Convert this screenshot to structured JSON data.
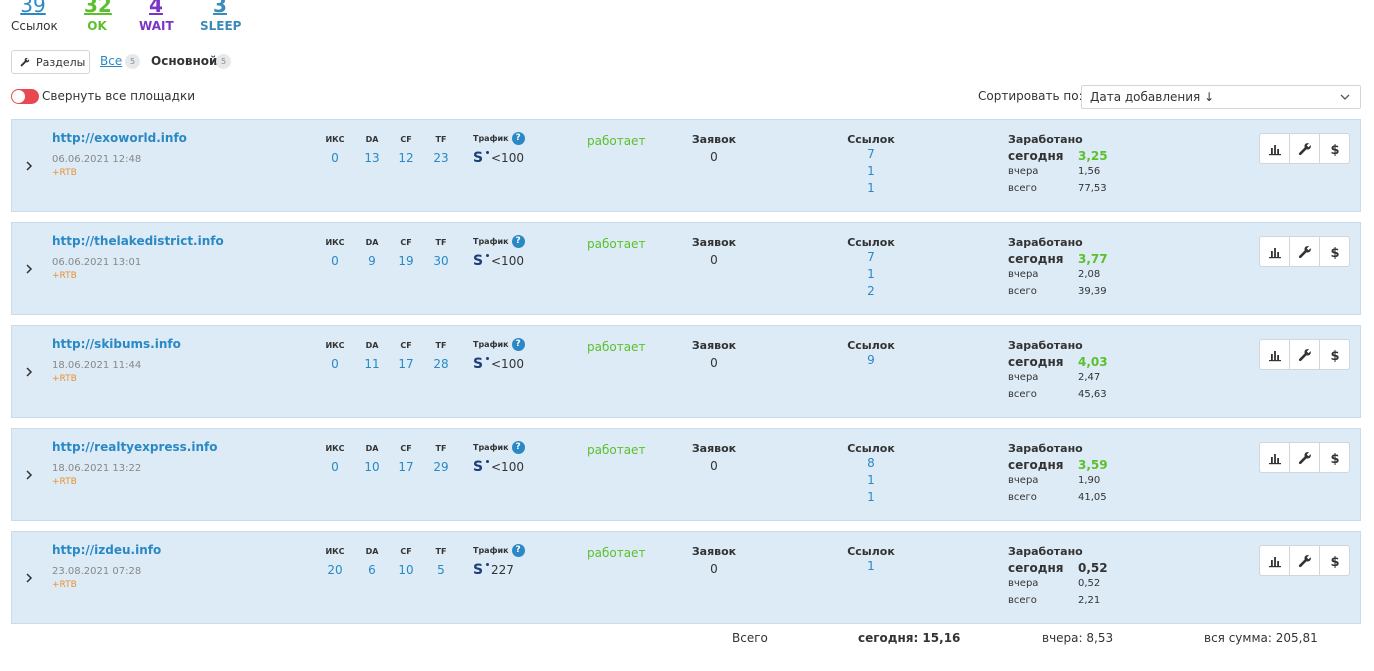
{
  "stats": {
    "links": {
      "value": "39",
      "label": "Ссылок",
      "color": "#2a89c4"
    },
    "ok": {
      "value": "32",
      "label": "OK",
      "color": "#5cc02c"
    },
    "wait": {
      "value": "4",
      "label": "WAIT",
      "color": "#7a35c4"
    },
    "sleep": {
      "value": "3",
      "label": "SLEEP",
      "color": "#3a8bb8"
    }
  },
  "sections": {
    "button_label": "Разделы",
    "button_icon": "wrench-icon",
    "tab_all": "Все",
    "tab_all_count": "5",
    "tab_main": "Основной",
    "tab_main_count": "5"
  },
  "toggle": {
    "label": "Свернуть все площадки",
    "state": "off",
    "color": "#e8484f"
  },
  "sort": {
    "label": "Сортировать по:",
    "selected": "Дата добавления ↓"
  },
  "columns": {
    "iks": "ИКС",
    "da": "DA",
    "cf": "CF",
    "tf": "TF",
    "traffic": "Трафик",
    "requests": "Заявок",
    "links": "Ссылок",
    "earned": "Заработано",
    "today": "сегодня",
    "yesterday": "вчера",
    "total": "всего"
  },
  "sites": [
    {
      "url": "http://exoworld.info",
      "date": "06.06.2021 12:48",
      "tag": "+RTB",
      "iks": "0",
      "da": "13",
      "cf": "12",
      "tf": "23",
      "traffic": "<100",
      "status": "работает",
      "requests": "0",
      "links": [
        "7",
        "1",
        "1"
      ],
      "today": "3,25",
      "yesterday": "1,56",
      "total": "77,53",
      "today_highlight": true
    },
    {
      "url": "http://thelakedistrict.info",
      "date": "06.06.2021 13:01",
      "tag": "+RTB",
      "iks": "0",
      "da": "9",
      "cf": "19",
      "tf": "30",
      "traffic": "<100",
      "status": "работает",
      "requests": "0",
      "links": [
        "7",
        "1",
        "2"
      ],
      "today": "3,77",
      "yesterday": "2,08",
      "total": "39,39",
      "today_highlight": true
    },
    {
      "url": "http://skibums.info",
      "date": "18.06.2021 11:44",
      "tag": "+RTB",
      "iks": "0",
      "da": "11",
      "cf": "17",
      "tf": "28",
      "traffic": "<100",
      "status": "работает",
      "requests": "0",
      "links": [
        "9"
      ],
      "today": "4,03",
      "yesterday": "2,47",
      "total": "45,63",
      "today_highlight": true
    },
    {
      "url": "http://realtyexpress.info",
      "date": "18.06.2021 13:22",
      "tag": "+RTB",
      "iks": "0",
      "da": "10",
      "cf": "17",
      "tf": "29",
      "traffic": "<100",
      "status": "работает",
      "requests": "0",
      "links": [
        "8",
        "1",
        "1"
      ],
      "today": "3,59",
      "yesterday": "1,90",
      "total": "41,05",
      "today_highlight": true
    },
    {
      "url": "http://izdeu.info",
      "date": "23.08.2021 07:28",
      "tag": "+RTB",
      "iks": "20",
      "da": "6",
      "cf": "10",
      "tf": "5",
      "traffic": "227",
      "status": "работает",
      "requests": "0",
      "links": [
        "1"
      ],
      "today": "0,52",
      "yesterday": "0,52",
      "total": "2,21",
      "today_highlight": false
    }
  ],
  "row_actions": [
    {
      "name": "stats-button",
      "icon": "bar-chart-icon"
    },
    {
      "name": "settings-button",
      "icon": "wrench-icon"
    },
    {
      "name": "finance-button",
      "icon": "dollar-icon"
    }
  ],
  "totals": {
    "label": "Всего",
    "today": "сегодня: 15,16",
    "yesterday": "вчера: 8,53",
    "all": "вся сумма: 205,81"
  },
  "colors": {
    "accent": "#2a89c4",
    "ok": "#5cc02c",
    "row_bg": "#dcebf6",
    "rtb": "#e8922f"
  }
}
